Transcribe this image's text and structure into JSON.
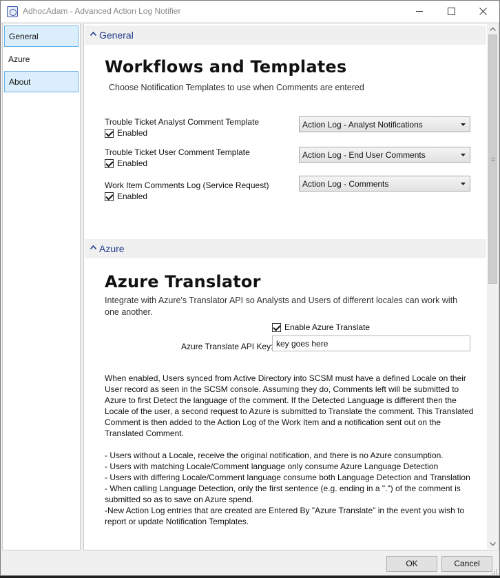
{
  "window": {
    "title": "AdhocAdam - Advanced Action Log Notifier"
  },
  "sidebar": {
    "items": [
      {
        "label": "General"
      },
      {
        "label": "Azure"
      },
      {
        "label": "About"
      }
    ]
  },
  "general_section": {
    "header": "General",
    "heading": "Workflows and Templates",
    "subtitle": "Choose Notification Templates to use when Comments are entered",
    "rows": [
      {
        "label": "Trouble Ticket Analyst Comment Template",
        "checkbox_label": "Enabled",
        "checked": true,
        "template": "Action Log - Analyst Notifications"
      },
      {
        "label": "Trouble Ticket User Comment Template",
        "checkbox_label": "Enabled",
        "checked": true,
        "template": "Action Log - End User Comments"
      },
      {
        "label": "Work Item Comments Log (Service Request)",
        "checkbox_label": "Enabled",
        "checked": true,
        "template": "Action Log - Comments"
      }
    ]
  },
  "azure_section": {
    "header": "Azure",
    "heading": "Azure Translator",
    "description": "Integrate with Azure's Translator API so Analysts and Users of different locales can work with one another.",
    "enable_label": "Enable Azure Translate",
    "enable_checked": true,
    "api_key_label": "Azure Translate API Key:",
    "api_key_value": "key goes here",
    "info_paragraph": "When enabled, Users synced from Active Directory into SCSM must have a defined Locale on their User record as seen in the SCSM console. Assuming they do, Comments left will be submitted to Azure to first Detect the language of the comment. If the Detected Language is different then the Locale of the user, a second request to Azure is submitted to Translate the comment. This Translated Comment is then added to the Action Log of the Work Item and a notification sent out on the Translated Comment.",
    "bullets": [
      "- Users without a Locale, receive the original notification, and there is no Azure consumption.",
      "- Users with matching Locale/Comment language only consume Azure Language Detection",
      "- Users with differing Locale/Comment language consume both Language Detection and Translation",
      "- When calling Language Detection, only the first sentence (e.g. ending in a \".\") of the comment is submitted so as to save on Azure spend.",
      "-New Action Log entries that are created are Entered By \"Azure Translate\" in the event you wish to report or update Notification Templates."
    ]
  },
  "footer": {
    "ok_label": "OK",
    "cancel_label": "Cancel"
  },
  "icons": {
    "app": "app-icon",
    "minimize": "minimize-icon",
    "maximize": "maximize-icon",
    "close": "close-icon",
    "collapse": "collapse-caret-icon",
    "dropdown": "dropdown-arrow-icon"
  }
}
